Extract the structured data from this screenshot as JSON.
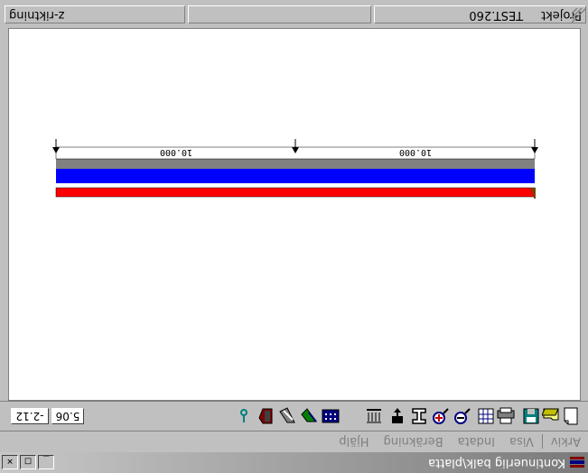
{
  "window": {
    "title": "Kontinuerlig balk\\platta",
    "minimize_label": "_",
    "maximize_label": "□",
    "close_label": "✕"
  },
  "menu": {
    "items": [
      "Arkiv",
      "Visa",
      "Indata",
      "Beräkning",
      "Hjälp"
    ]
  },
  "toolbar": {
    "icons": [
      "new-file-icon",
      "open-file-icon",
      "save-icon",
      "print-icon",
      "table-icon",
      "zoom-out-icon",
      "zoom-in-icon",
      "section-icon",
      "point-load-icon",
      "distributed-load-icon",
      "calculator-icon",
      "moment-diagram-icon",
      "shear-diagram-icon",
      "reinforcement-icon",
      "help-hook-icon"
    ],
    "coord_x": "5.06",
    "coord_y": "-2.12"
  },
  "beam": {
    "spans": [
      "10.000",
      "10.000"
    ],
    "colors": {
      "top": "#ff0000",
      "middle": "#0000ff",
      "bottom": "#808080",
      "support": "#804000"
    }
  },
  "status": {
    "direction": "z-riktning",
    "middle": "",
    "project_label": "Projekt",
    "project_name": "TEST.260"
  }
}
